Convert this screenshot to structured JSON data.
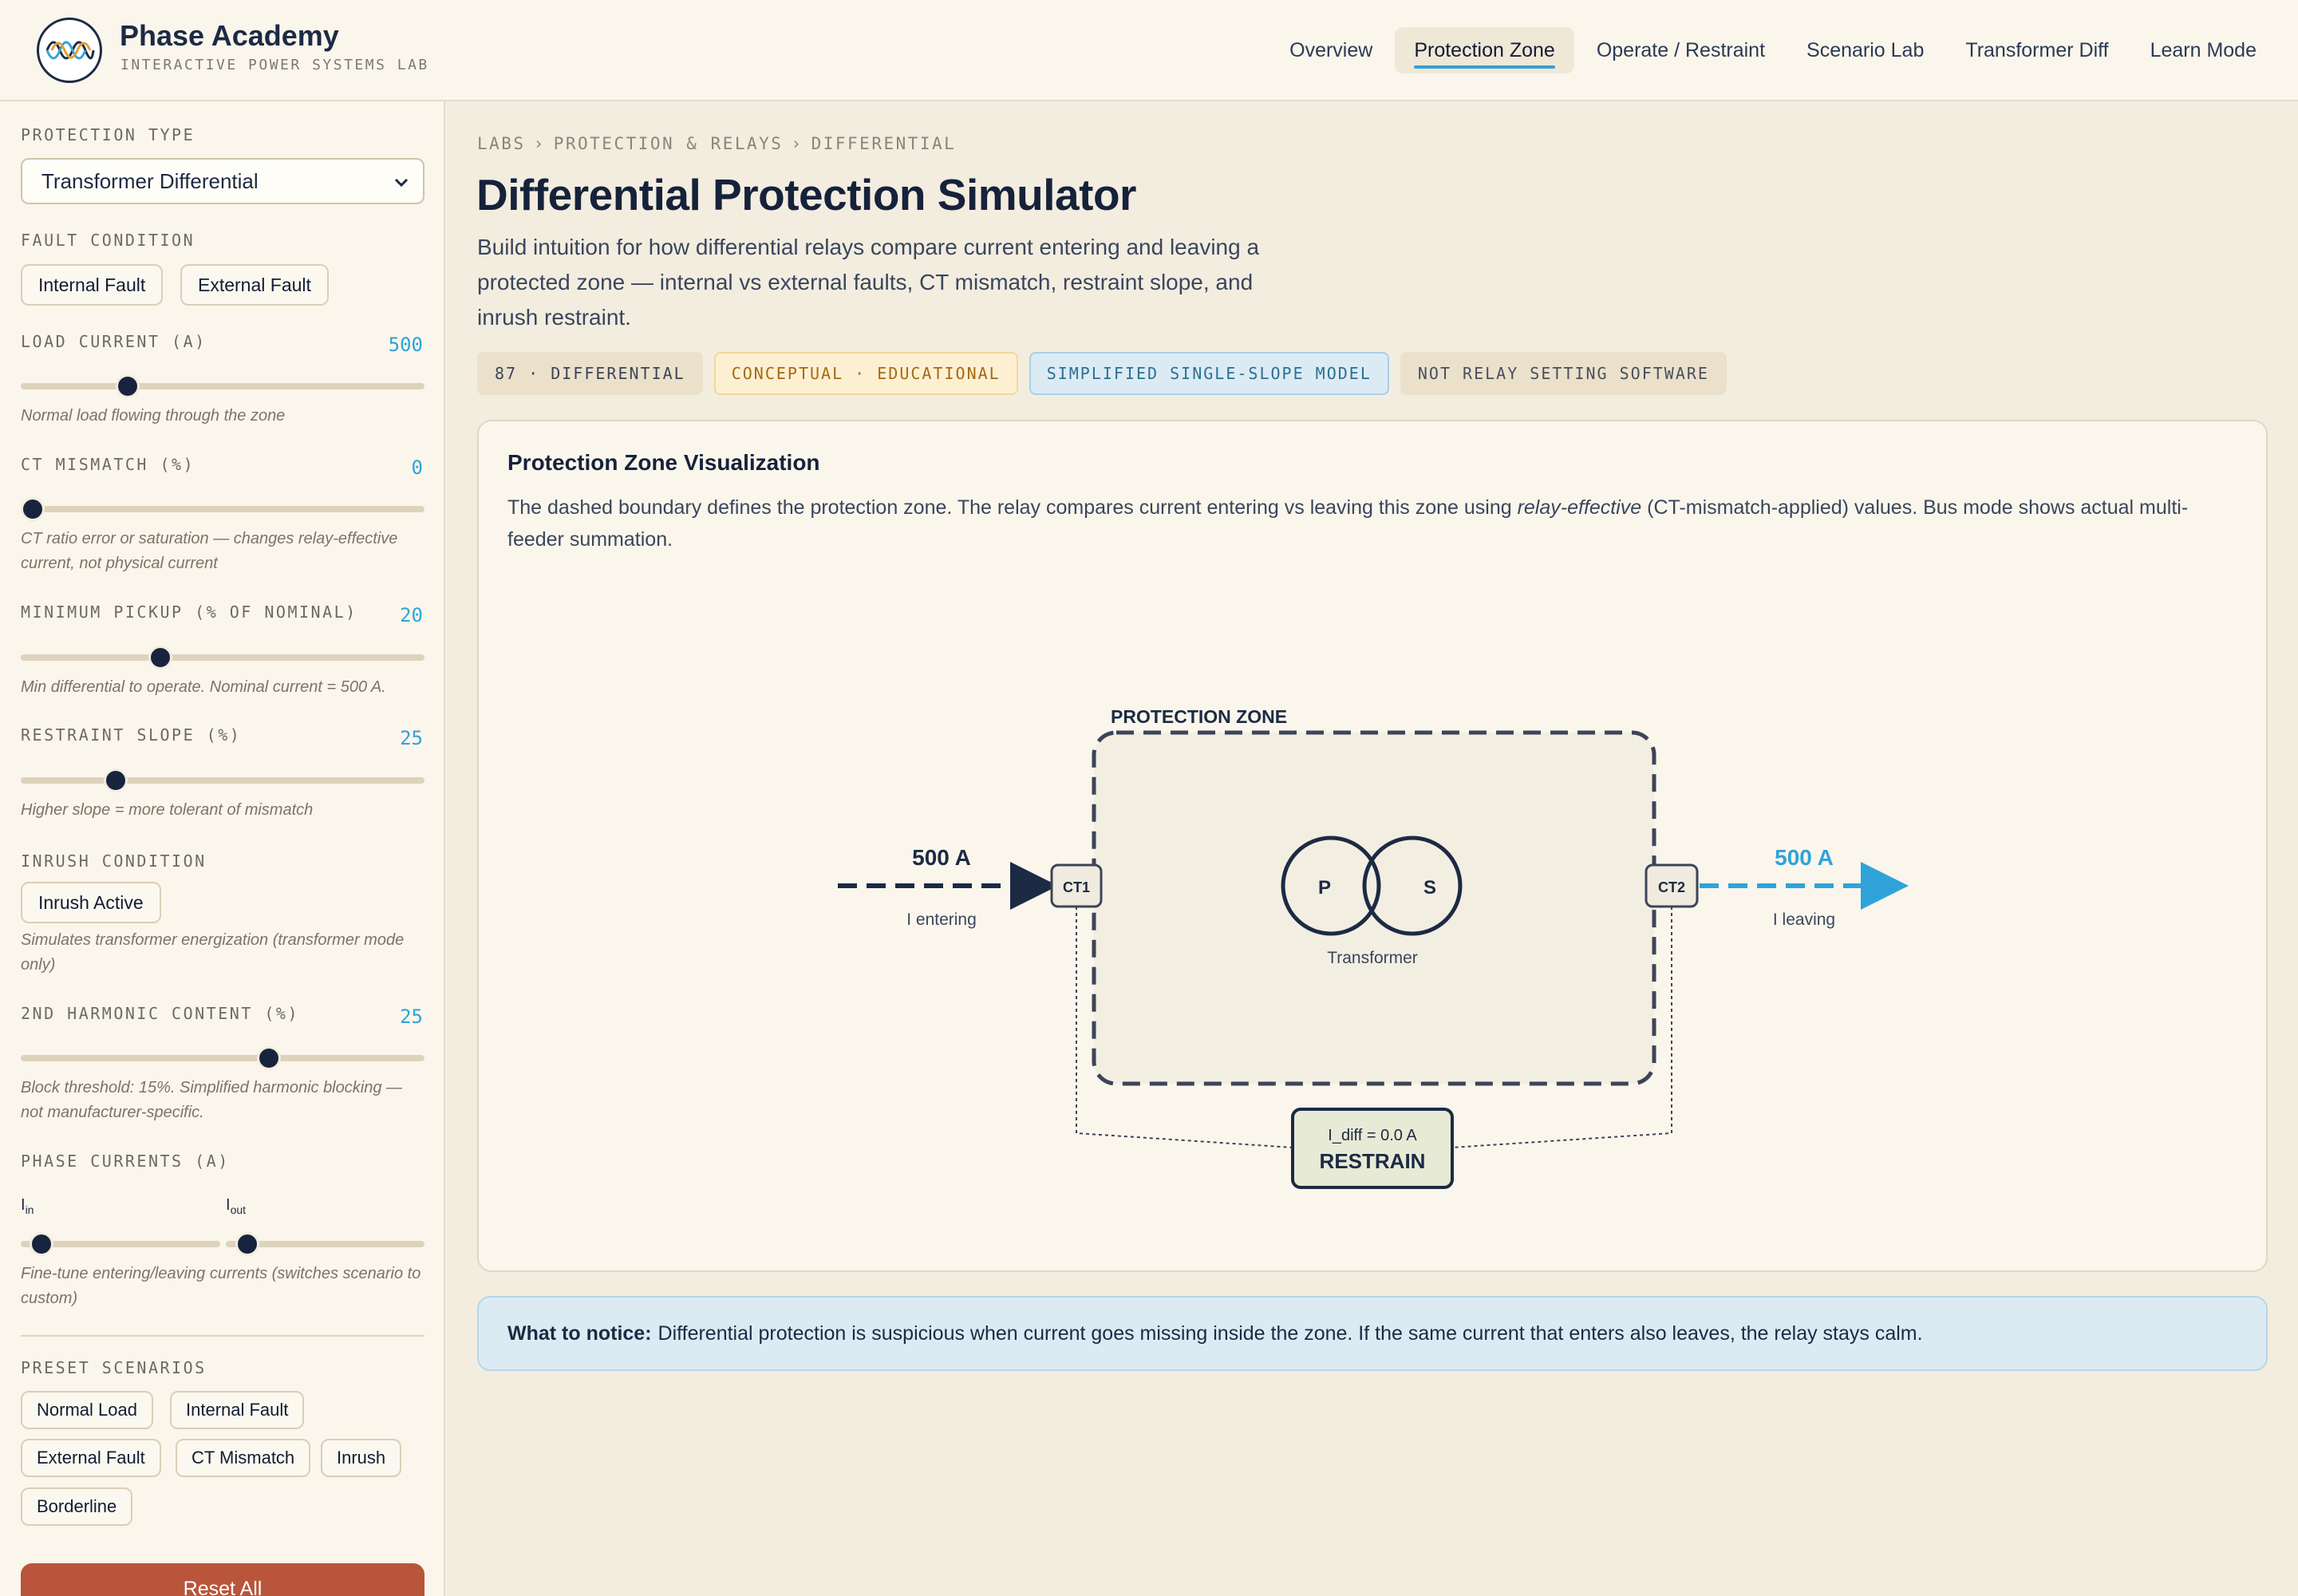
{
  "app": {
    "title": "Phase Academy",
    "subtitle": "INTERACTIVE POWER SYSTEMS LAB"
  },
  "nav": [
    {
      "label": "Overview",
      "active": false
    },
    {
      "label": "Protection Zone",
      "active": true
    },
    {
      "label": "Operate / Restraint",
      "active": false
    },
    {
      "label": "Scenario Lab",
      "active": false
    },
    {
      "label": "Transformer Diff",
      "active": false
    },
    {
      "label": "Learn Mode",
      "active": false
    }
  ],
  "sidebar": {
    "protection_type": {
      "label": "PROTECTION TYPE",
      "value": "Transformer Differential"
    },
    "fault_condition": {
      "label": "FAULT CONDITION",
      "options": [
        "Internal Fault",
        "External Fault"
      ]
    },
    "load_current": {
      "label": "LOAD CURRENT (A)",
      "value": "500",
      "note": "Normal load flowing through the zone",
      "fraction": 0.265
    },
    "ct_mismatch": {
      "label": "CT MISMATCH (%)",
      "value": "0",
      "note": "CT ratio error or saturation — changes relay-effective current, not physical current",
      "fraction": 0.03
    },
    "min_pickup": {
      "label": "MINIMUM PICKUP (% OF NOMINAL)",
      "value": "20",
      "note": "Min differential to operate. Nominal current = 500 A.",
      "fraction": 0.345
    },
    "restraint_slope": {
      "label": "RESTRAINT SLOPE (%)",
      "value": "25",
      "note": "Higher slope = more tolerant of mismatch",
      "fraction": 0.235
    },
    "inrush": {
      "label": "INRUSH CONDITION",
      "button": "Inrush Active",
      "note": "Simulates transformer energization (transformer mode only)"
    },
    "harmonic": {
      "label": "2ND HARMONIC CONTENT (%)",
      "value": "25",
      "note": "Block threshold: 15%. Simplified harmonic blocking — not manufacturer-specific.",
      "fraction": 0.615
    },
    "phase_currents": {
      "label": "PHASE CURRENTS (A)",
      "in_label": "I",
      "in_sub": "in",
      "out_label": "I",
      "out_sub": "out",
      "note": "Fine-tune entering/leaving currents (switches scenario to custom)"
    },
    "presets": {
      "label": "PRESET SCENARIOS",
      "items": [
        "Normal Load",
        "Internal Fault",
        "External Fault",
        "CT Mismatch",
        "Inrush",
        "Borderline"
      ]
    },
    "reset": "Reset All"
  },
  "main": {
    "breadcrumb": [
      "LABS",
      "PROTECTION & RELAYS",
      "DIFFERENTIAL"
    ],
    "title": "Differential Protection Simulator",
    "description": "Build intuition for how differential relays compare current entering and leaving a protected zone — internal vs external faults, CT mismatch, restraint slope, and inrush restraint.",
    "tags": [
      "87 · DIFFERENTIAL",
      "CONCEPTUAL · EDUCATIONAL",
      "SIMPLIFIED SINGLE-SLOPE MODEL",
      "NOT RELAY SETTING SOFTWARE"
    ]
  },
  "viz": {
    "title": "Protection Zone Visualization",
    "desc_pre": "The dashed boundary defines the protection zone. The relay compares current entering vs leaving this zone using ",
    "desc_em": "relay-effective",
    "desc_post": " (CT-mismatch-applied) values. Bus mode shows actual multi-feeder summation.",
    "zone_label": "PROTECTION ZONE",
    "current_in": "500 A",
    "current_in_label": "I entering",
    "current_out": "500 A",
    "current_out_label": "I leaving",
    "ct1": "CT1",
    "ct2": "CT2",
    "primary": "P",
    "secondary": "S",
    "device_label": "Transformer",
    "relay_idiff": "I_diff = 0.0 A",
    "relay_state": "RESTRAIN"
  },
  "notice": {
    "bold": "What to notice:",
    "text": "Differential protection is suspicious when current goes missing inside the zone. If the same current that enters also leaves, the relay stays calm."
  },
  "colors": {
    "accent": "#2fa3d9",
    "navy": "#1c2a44",
    "reset": "#b9553a",
    "background": "#f3ede0"
  }
}
